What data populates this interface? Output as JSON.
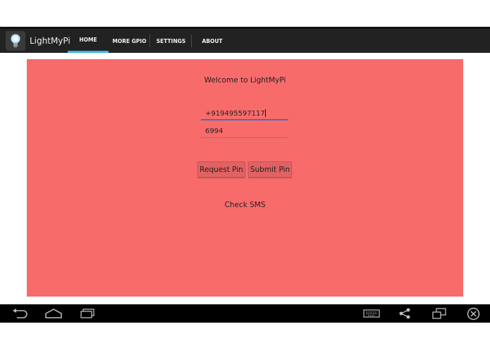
{
  "app": {
    "title": "LightMyPi",
    "icon": "lightbulb-icon"
  },
  "tabs": [
    {
      "label": "HOME",
      "active": true
    },
    {
      "label": "MORE GPIO",
      "active": false
    },
    {
      "label": "SETTINGS",
      "active": false
    },
    {
      "label": "ABOUT",
      "active": false
    }
  ],
  "main": {
    "welcome": "Welcome to LightMyPi",
    "phone_value": "+919495597117",
    "pin_value": "6994",
    "request_pin_label": "Request Pin",
    "submit_pin_label": "Submit Pin",
    "status": "Check SMS",
    "background_color": "#f86b6b",
    "tab_indicator_color": "#33b5e5"
  },
  "navbar": {
    "left_icons": [
      "back-icon",
      "home-icon",
      "recent-apps-icon"
    ],
    "right_icons": [
      "keyboard-icon",
      "share-icon",
      "multi-window-icon",
      "close-icon"
    ]
  }
}
